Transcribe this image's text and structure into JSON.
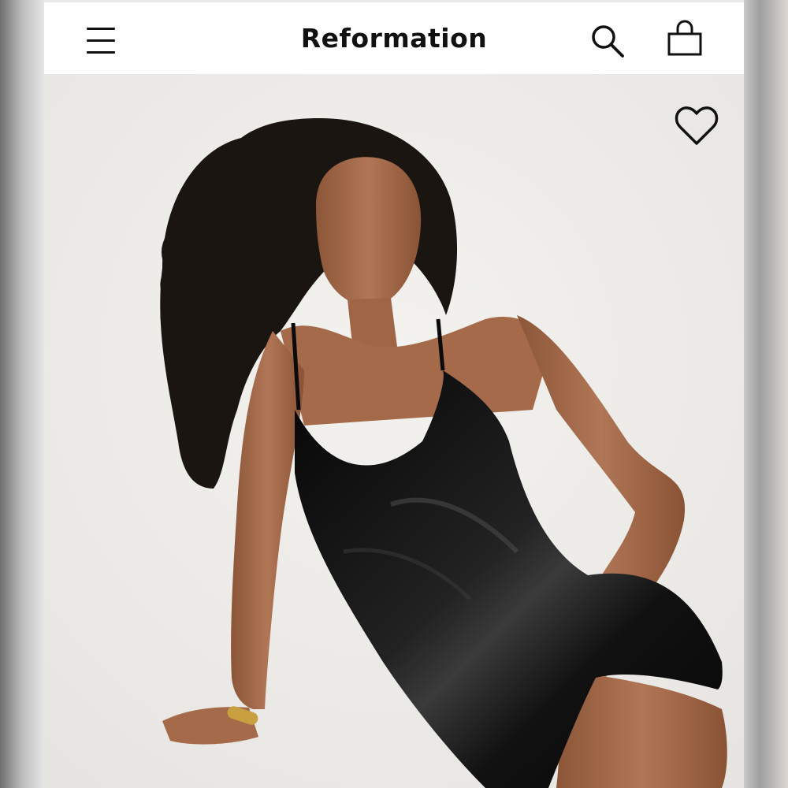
{
  "header": {
    "brand": "Reformation",
    "menu_icon": "hamburger-menu-icon",
    "search_icon": "search-icon",
    "bag_icon": "shopping-bag-icon"
  },
  "product": {
    "wishlist_icon": "heart-outline-icon",
    "image_subject": "model-in-black-satin-slip-dress"
  },
  "colors": {
    "header_bg": "#ffffff",
    "photo_bg": "#efeeeb",
    "dress": "#121212",
    "skin": "#a46a4a",
    "hair": "#1a1410"
  }
}
